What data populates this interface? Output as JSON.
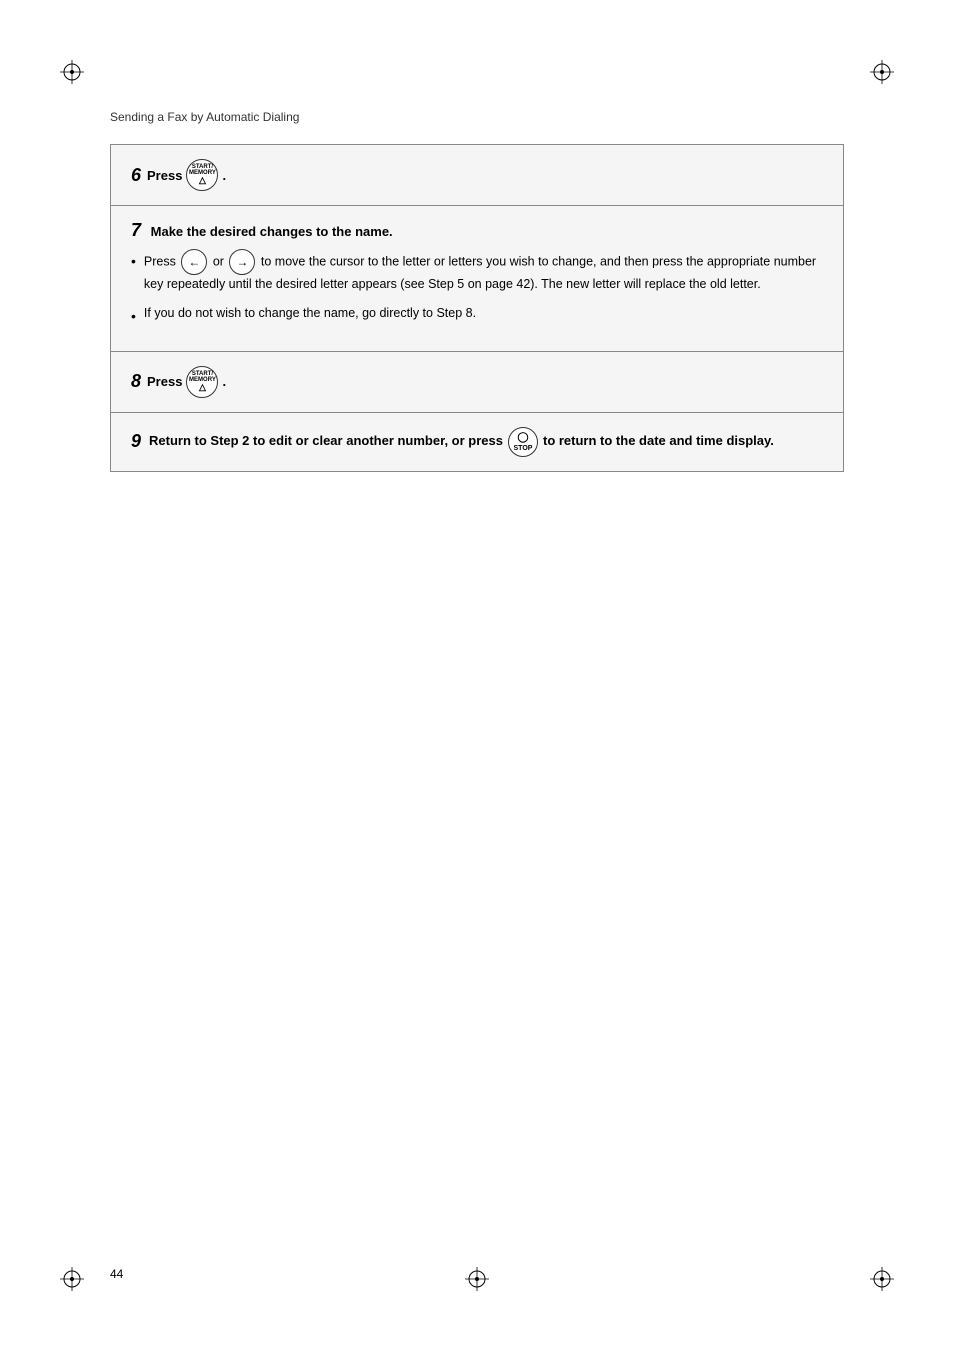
{
  "page": {
    "header": "Sending a Fax by Automatic Dialing",
    "page_number": "44"
  },
  "steps": [
    {
      "id": "step6",
      "number": "6",
      "inline_label": "Press",
      "key": "START_MEMORY",
      "has_period": true,
      "bullets": []
    },
    {
      "id": "step7",
      "number": "7",
      "title": "Make the desired changes to the name.",
      "bullets": [
        {
          "text_parts": [
            {
              "type": "text",
              "value": "Press "
            },
            {
              "type": "key",
              "value": "left_arrow"
            },
            {
              "type": "text",
              "value": " or "
            },
            {
              "type": "key",
              "value": "right_arrow"
            },
            {
              "type": "text",
              "value": " to move the cursor to the letter or letters you wish to change, and then press the appropriate number key repeatedly until the desired letter appears (see Step 5 on page 42). The new letter will replace the old letter."
            }
          ]
        },
        {
          "text_parts": [
            {
              "type": "text",
              "value": "If you do not wish to change the name, go directly to Step 8."
            }
          ]
        }
      ]
    },
    {
      "id": "step8",
      "number": "8",
      "inline_label": "Press",
      "key": "START_MEMORY",
      "has_period": true,
      "bullets": []
    },
    {
      "id": "step9",
      "number": "9",
      "text_before_key": "Return to Step 2 to edit or clear another number, or press ",
      "key": "STOP",
      "text_after_key": " to return to the date and time display.",
      "is_inline_with_text": true,
      "bullets": []
    }
  ]
}
